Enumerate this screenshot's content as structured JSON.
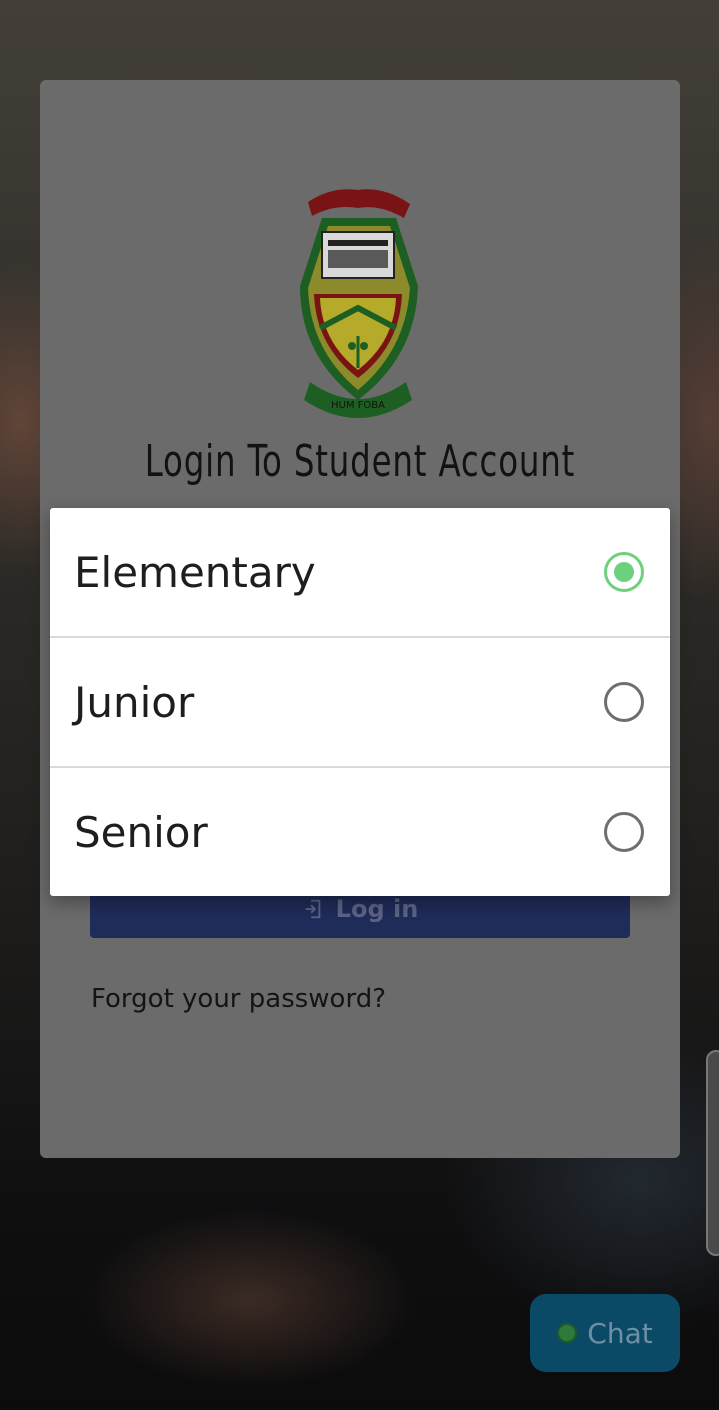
{
  "login": {
    "title": "Login To Student Account",
    "crest_motto": "HUM FOBA",
    "login_label": "Log in",
    "forgot_password": "Forgot your password?"
  },
  "chat": {
    "label": "Chat",
    "status_color": "#2f7a3b"
  },
  "level_dialog": {
    "options": [
      {
        "label": "Elementary",
        "selected": true
      },
      {
        "label": "Junior",
        "selected": false
      },
      {
        "label": "Senior",
        "selected": false
      }
    ],
    "accent_color": "#6dd07d"
  },
  "icons": {
    "login": "login-icon",
    "radio_checked": "radio-checked-icon",
    "radio_unchecked": "radio-unchecked-icon"
  }
}
